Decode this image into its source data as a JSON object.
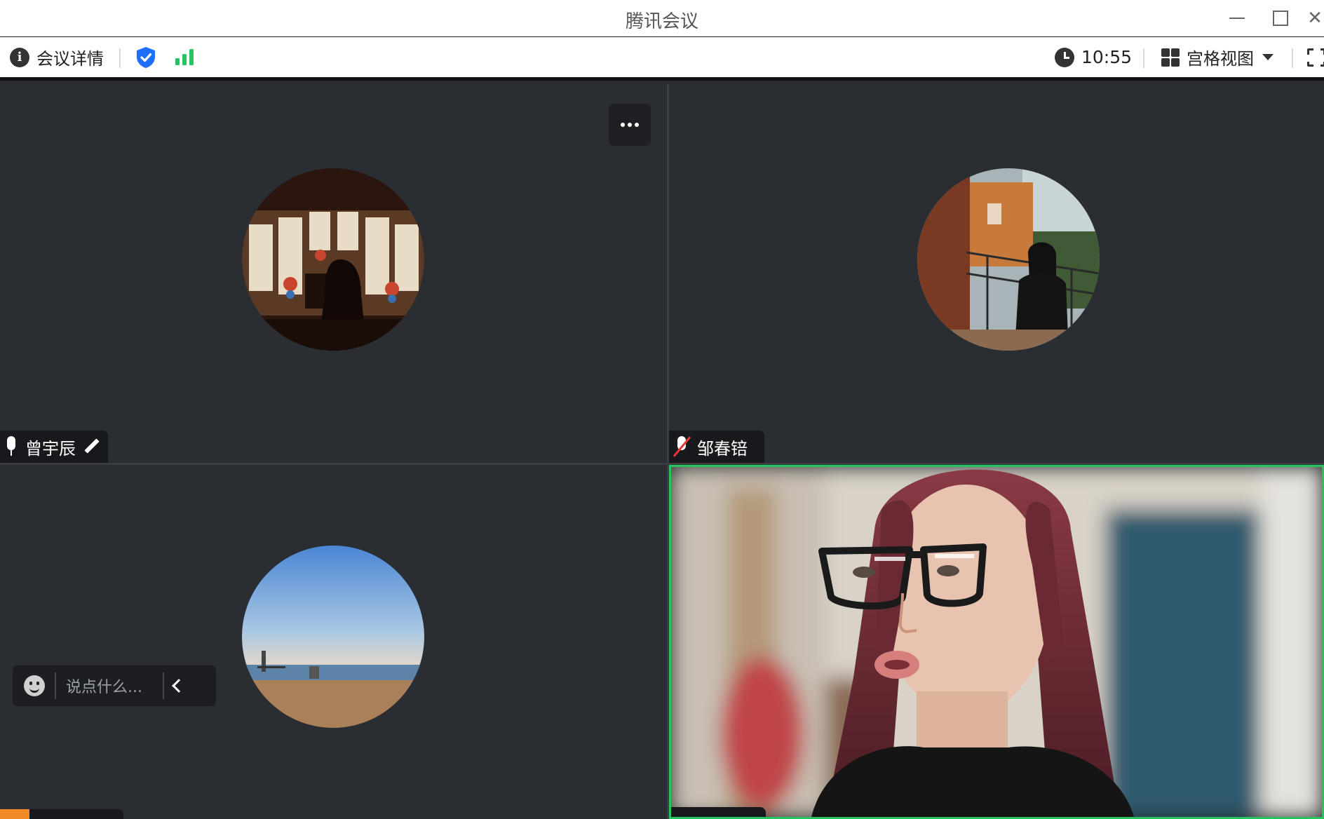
{
  "window": {
    "title": "腾讯会议"
  },
  "toolbar": {
    "meeting_details_label": "会议详情",
    "time": "10:55",
    "view_mode_label": "宫格视图"
  },
  "participants": [
    {
      "name": "曾宇辰",
      "mic": "on",
      "avatar": "church-window-photo",
      "has_video": false
    },
    {
      "name": "邹春锫",
      "mic": "muted",
      "avatar": "balcony-photo",
      "has_video": false
    },
    {
      "name": "",
      "mic": "",
      "avatar": "beach-photo",
      "has_video": false
    },
    {
      "name": "",
      "mic": "",
      "avatar": "",
      "has_video": true,
      "active_speaker": true
    }
  ],
  "chat": {
    "placeholder": "说点什么..."
  },
  "colors": {
    "active_speaker_border": "#22c55e",
    "shield_blue": "#1e6fff",
    "signal_green": "#22c55e",
    "muted_red": "#e53935",
    "tile_bg": "#2a2d31"
  },
  "icons": [
    "info-icon",
    "shield-icon",
    "signal-icon",
    "clock-icon",
    "grid-view-icon",
    "fullscreen-icon",
    "more-icon",
    "mic-icon",
    "mic-muted-icon",
    "pen-icon",
    "emoji-icon",
    "chevron-left-icon"
  ]
}
